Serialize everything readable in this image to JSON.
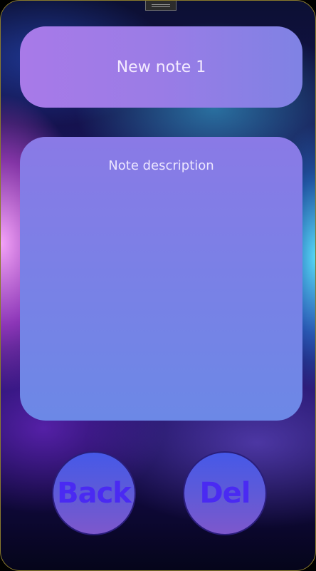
{
  "note": {
    "title": "New note 1",
    "description": "Note description"
  },
  "actions": {
    "back_label": "Back",
    "delete_label": "Del"
  },
  "colors": {
    "title_card": "#9a7ce6",
    "description_card": "#7b80e6",
    "button_fill": "#5e5ad8",
    "button_text": "#4a2af2"
  }
}
